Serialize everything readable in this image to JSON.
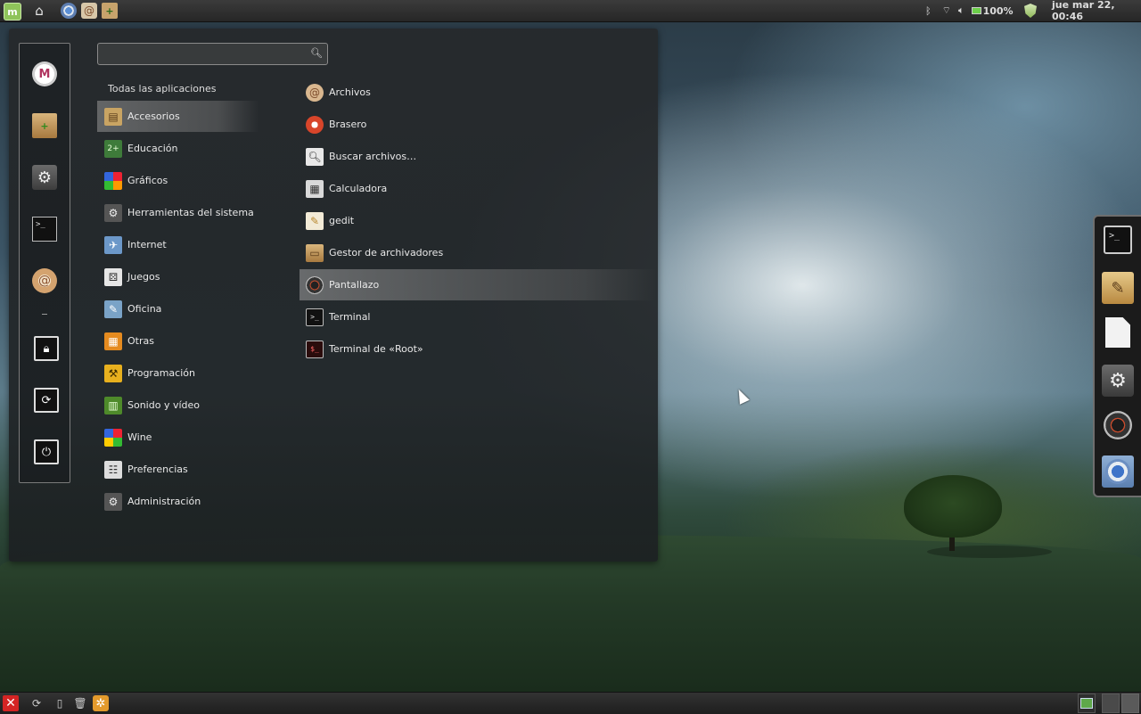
{
  "top_panel": {
    "launchers": [
      {
        "icon": "mint-menu-icon"
      },
      {
        "icon": "home-icon"
      },
      {
        "icon": "chromium-icon"
      },
      {
        "icon": "nautilus-icon"
      },
      {
        "icon": "package-installer-icon"
      }
    ],
    "tray": {
      "battery_percent": "100%",
      "clock": "jue mar 22, 00:46",
      "icons": [
        "bluetooth-icon",
        "wifi-icon",
        "volume-icon",
        "battery-icon",
        "update-shield-icon"
      ]
    }
  },
  "menu": {
    "search": {
      "value": "",
      "placeholder": ""
    },
    "favorites": [
      {
        "icon": "mint-install-icon"
      },
      {
        "icon": "package-icon"
      },
      {
        "icon": "settings-gear-icon"
      },
      {
        "icon": "terminal-icon"
      },
      {
        "icon": "files-shell-icon"
      }
    ],
    "session_actions": [
      {
        "icon": "lock-icon"
      },
      {
        "icon": "logout-icon"
      },
      {
        "icon": "power-icon"
      }
    ],
    "categories_header": "Todas las aplicaciones",
    "categories": [
      {
        "label": "Accesorios",
        "icon": "accessories-icon",
        "active": true
      },
      {
        "label": "Educación",
        "icon": "education-icon"
      },
      {
        "label": "Gráficos",
        "icon": "graphics-icon"
      },
      {
        "label": "Herramientas del sistema",
        "icon": "system-tools-icon"
      },
      {
        "label": "Internet",
        "icon": "internet-icon"
      },
      {
        "label": "Juegos",
        "icon": "games-icon"
      },
      {
        "label": "Oficina",
        "icon": "office-icon"
      },
      {
        "label": "Otras",
        "icon": "other-icon"
      },
      {
        "label": "Programación",
        "icon": "programming-icon"
      },
      {
        "label": "Sonido y vídeo",
        "icon": "sound-video-icon"
      },
      {
        "label": "Wine",
        "icon": "wine-icon"
      },
      {
        "label": "Preferencias",
        "icon": "preferences-icon"
      },
      {
        "label": "Administración",
        "icon": "administration-icon"
      }
    ],
    "applications": [
      {
        "label": "Archivos",
        "icon": "files-icon"
      },
      {
        "label": "Brasero",
        "icon": "brasero-icon"
      },
      {
        "label": "Buscar archivos…",
        "icon": "search-files-icon"
      },
      {
        "label": "Calculadora",
        "icon": "calculator-icon"
      },
      {
        "label": "gedit",
        "icon": "gedit-icon"
      },
      {
        "label": "Gestor de archivadores",
        "icon": "archive-manager-icon"
      },
      {
        "label": "Pantallazo",
        "icon": "screenshot-icon",
        "active": true
      },
      {
        "label": "Terminal",
        "icon": "terminal-icon"
      },
      {
        "label": "Terminal de «Root»",
        "icon": "root-terminal-icon"
      }
    ]
  },
  "dock": {
    "items": [
      {
        "icon": "terminal-icon"
      },
      {
        "icon": "text-editor-icon"
      },
      {
        "icon": "blank-document-icon"
      },
      {
        "icon": "settings-gear-icon"
      },
      {
        "icon": "camera-icon"
      },
      {
        "icon": "chromium-icon",
        "active": true
      }
    ]
  },
  "bottom_panel": {
    "icons": [
      "close-window-icon",
      "refresh-icon",
      "trash-icon",
      "clipboard-icon",
      "settings-icon"
    ],
    "workspaces": 3
  }
}
